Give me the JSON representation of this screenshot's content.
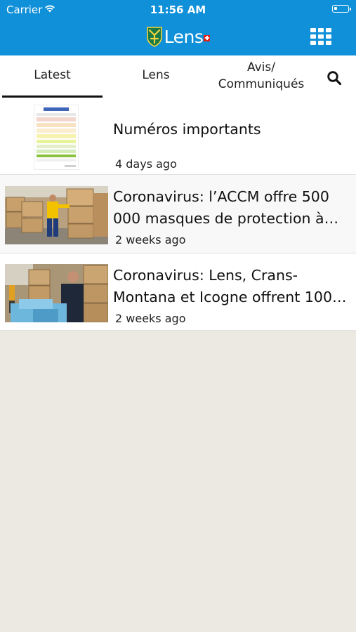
{
  "status_bar": {
    "carrier": "Carrier",
    "time": "11:56 AM"
  },
  "header": {
    "logo_text": "Lens",
    "menu_icon": "grid-icon",
    "bg_color": "#0f90d8"
  },
  "tabs": [
    {
      "label": "Latest",
      "active": true
    },
    {
      "label": "Lens",
      "active": false
    },
    {
      "label": "Avis/\nCommuniqués",
      "active": false
    }
  ],
  "search_icon": "search-icon",
  "articles": [
    {
      "title": "Numéros importants",
      "time": "4 days ago",
      "thumbnail": "document-table-image"
    },
    {
      "title": "Coronavirus: l’ACCM offre 500 000 masques de protection à s…",
      "time": "2 weeks ago",
      "thumbnail": "warehouse-boxes-photo"
    },
    {
      "title": "Coronavirus: Lens, Crans-Montana et Icogne offrent 100…",
      "time": "2 weeks ago",
      "thumbnail": "man-with-masks-photo"
    }
  ]
}
